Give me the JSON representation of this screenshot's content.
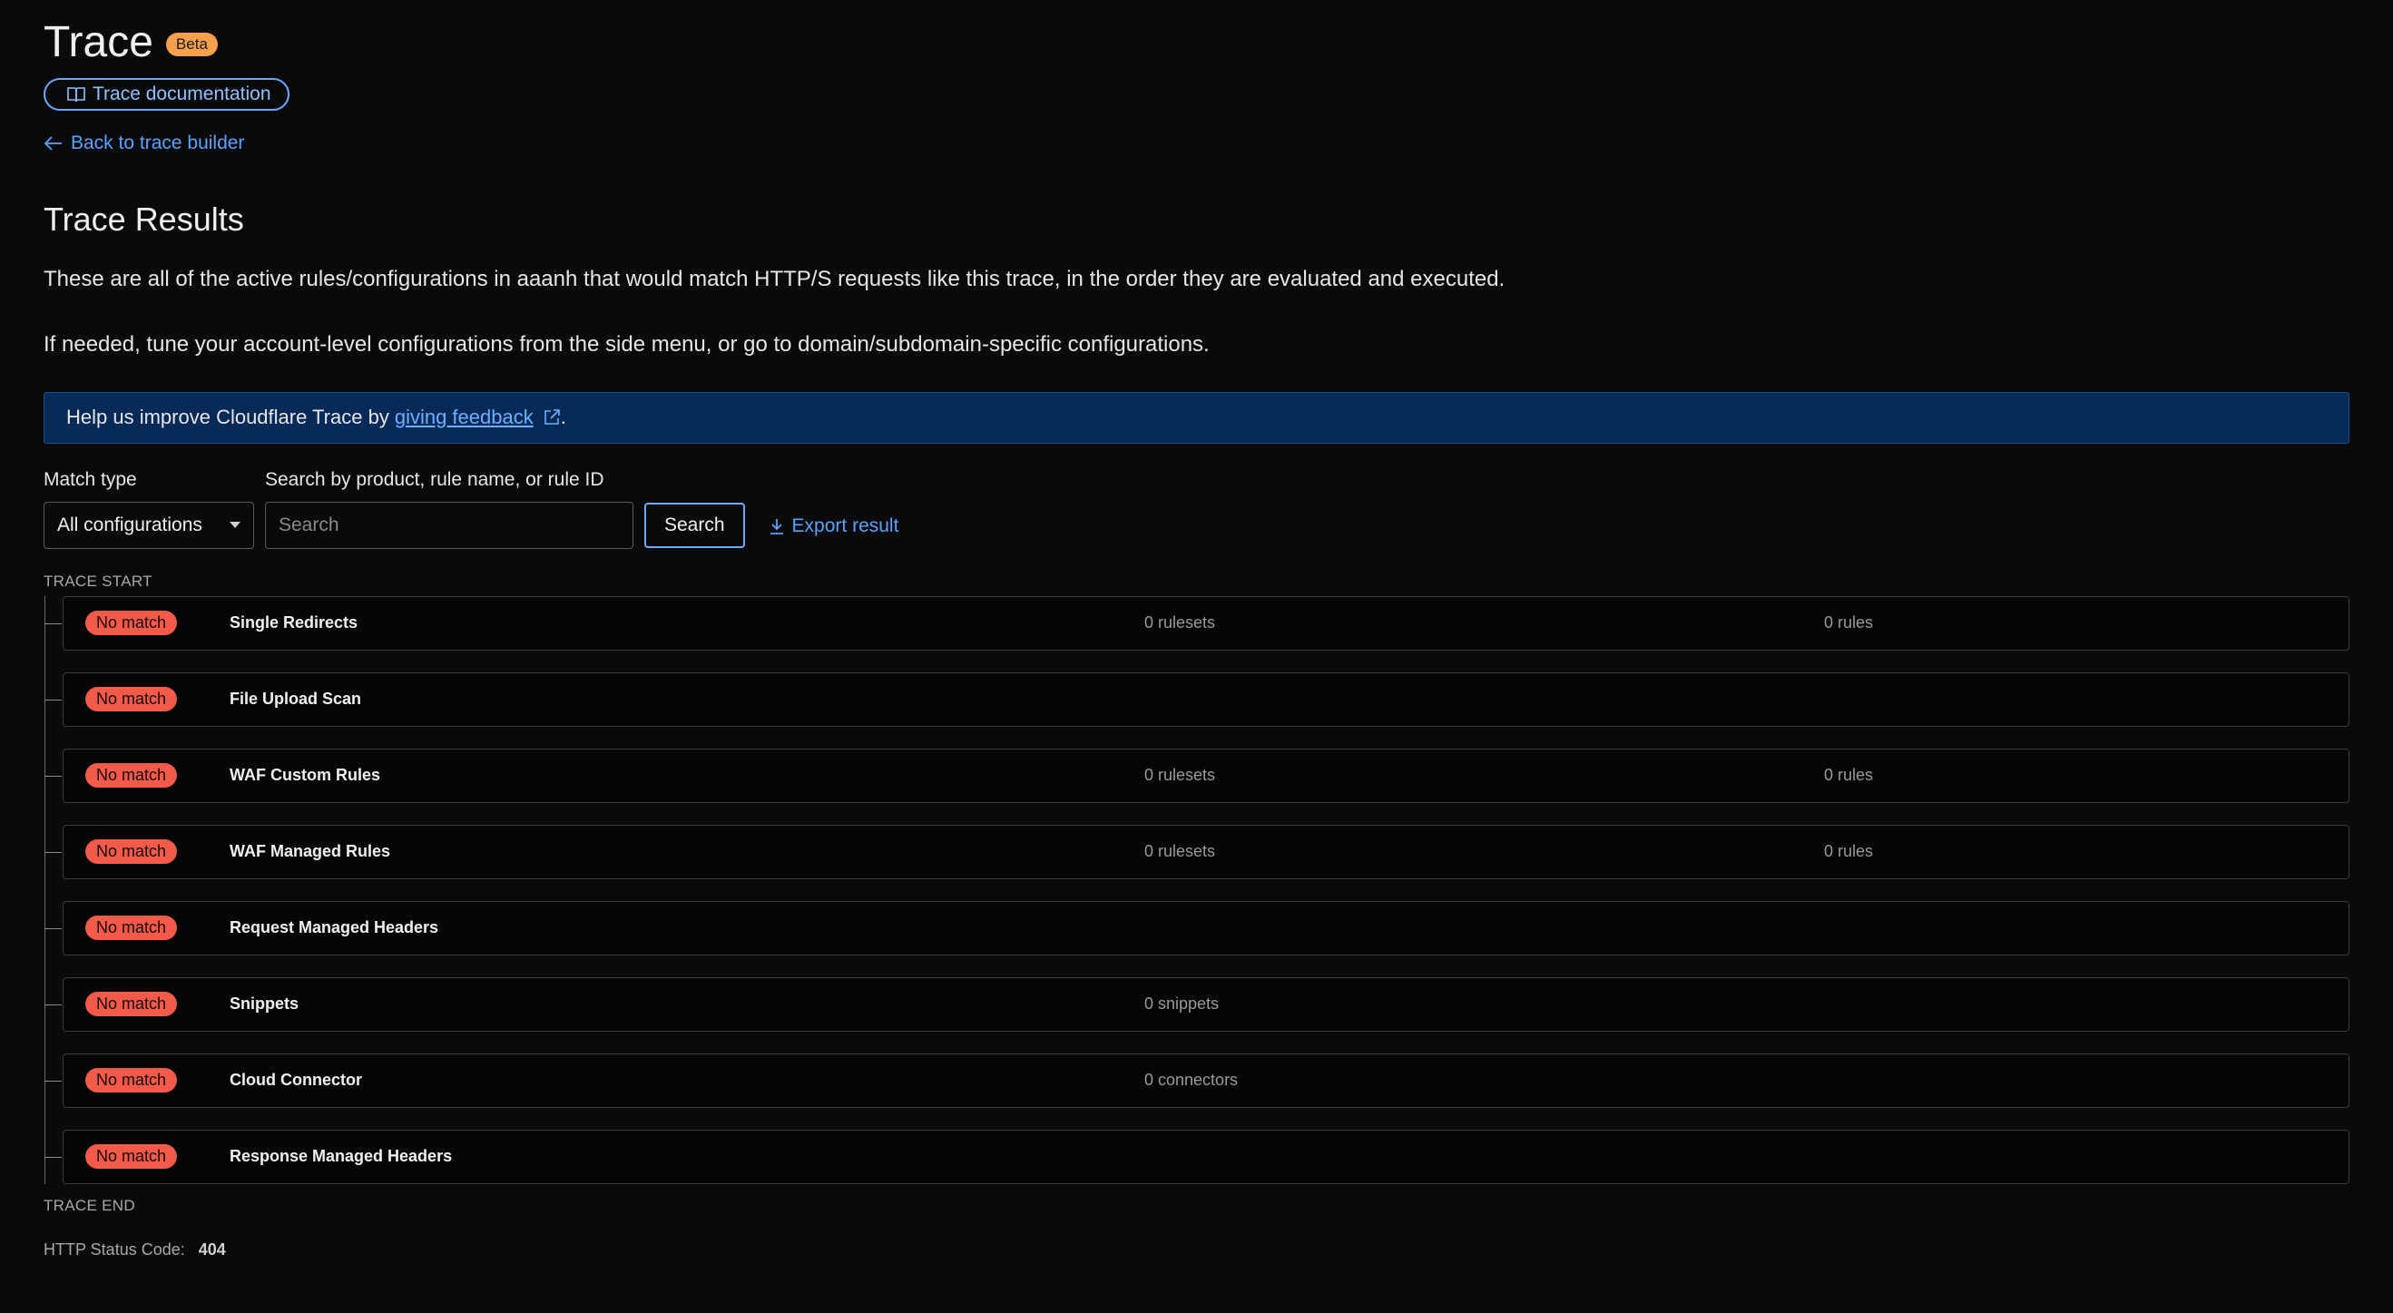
{
  "header": {
    "title": "Trace",
    "badge": "Beta",
    "doc_button": "Trace documentation",
    "back_link": "Back to trace builder"
  },
  "results": {
    "title": "Trace Results",
    "description_1": "These are all of the active rules/configurations in aaanh that would match HTTP/S requests like this trace, in the order they are evaluated and executed.",
    "description_2": "If needed, tune your account-level configurations from the side menu, or go to domain/subdomain-specific configurations."
  },
  "banner": {
    "text": "Help us improve Cloudflare Trace by",
    "link": "giving feedback",
    "suffix": "."
  },
  "filters": {
    "match_type_label": "Match type",
    "match_type_value": "All configurations",
    "search_label": "Search by product, rule name, or rule ID",
    "search_placeholder": "Search",
    "search_value": "",
    "search_button": "Search",
    "export_button": "Export result"
  },
  "trace": {
    "start_label": "TRACE START",
    "end_label": "TRACE END",
    "rows": [
      {
        "status": "No match",
        "name": "Single Redirects",
        "col1": "0 rulesets",
        "col2": "0 rules"
      },
      {
        "status": "No match",
        "name": "File Upload Scan",
        "col1": "",
        "col2": ""
      },
      {
        "status": "No match",
        "name": "WAF Custom Rules",
        "col1": "0 rulesets",
        "col2": "0 rules"
      },
      {
        "status": "No match",
        "name": "WAF Managed Rules",
        "col1": "0 rulesets",
        "col2": "0 rules"
      },
      {
        "status": "No match",
        "name": "Request Managed Headers",
        "col1": "",
        "col2": ""
      },
      {
        "status": "No match",
        "name": "Snippets",
        "col1": "0 snippets",
        "col2": ""
      },
      {
        "status": "No match",
        "name": "Cloud Connector",
        "col1": "0 connectors",
        "col2": ""
      },
      {
        "status": "No match",
        "name": "Response Managed Headers",
        "col1": "",
        "col2": ""
      }
    ],
    "status_code_label": "HTTP Status Code:",
    "status_code_value": "404"
  },
  "icons": {
    "doc_button": "book-icon",
    "back_link": "arrow-left-icon",
    "banner": "external-link-icon",
    "select": "caret-down-icon",
    "export": "download-icon"
  },
  "colors": {
    "background": "#0a0a0a",
    "accent": "#5aa2ff",
    "beta_badge": "#f6a04d",
    "no_match": "#f25a4a",
    "banner_bg": "#062a57"
  }
}
